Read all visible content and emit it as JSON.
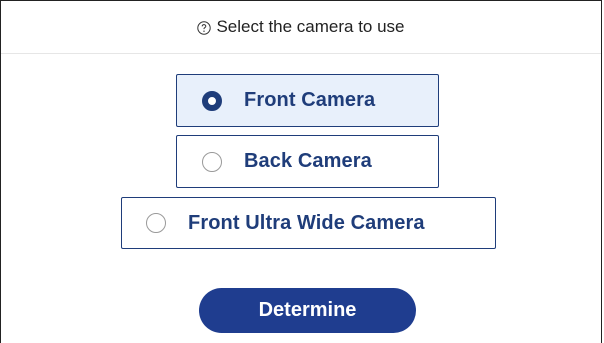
{
  "dialog": {
    "title": "Select the camera to use",
    "help_icon": "question-circle-icon"
  },
  "options": [
    {
      "label": "Front Camera",
      "selected": true
    },
    {
      "label": "Back Camera",
      "selected": false
    },
    {
      "label": "Front Ultra Wide Camera",
      "selected": false
    }
  ],
  "actions": {
    "determine_label": "Determine"
  },
  "colors": {
    "accent": "#1f3d7a",
    "button": "#1f3d8f",
    "selected_bg": "#e8f0fb",
    "radio_unchecked": "#9a9a9a"
  }
}
